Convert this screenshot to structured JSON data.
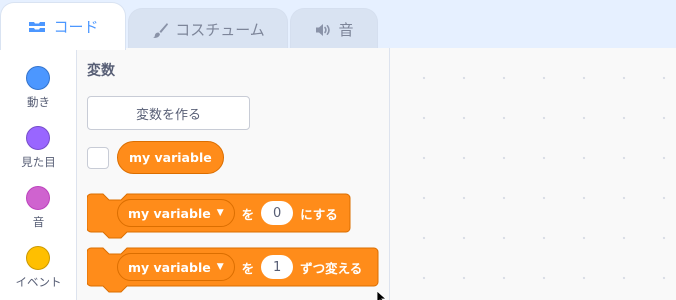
{
  "tabs": [
    {
      "label": "コード",
      "icon": "code-icon",
      "active": true
    },
    {
      "label": "コスチューム",
      "icon": "paintbrush-icon",
      "active": false
    },
    {
      "label": "音",
      "icon": "speaker-icon",
      "active": false
    }
  ],
  "categories": [
    {
      "label": "動き",
      "color": "#4c97ff",
      "border": "#3373cc"
    },
    {
      "label": "見た目",
      "color": "#9966ff",
      "border": "#774dcb"
    },
    {
      "label": "音",
      "color": "#cf63cf",
      "border": "#bd42bd"
    },
    {
      "label": "イベント",
      "color": "#ffbf00",
      "border": "#cc9900"
    }
  ],
  "flyout": {
    "title": "変数",
    "make_variable_button": "変数を作る",
    "variable": {
      "name": "my variable",
      "checked": false
    },
    "blocks": [
      {
        "variable": "my variable",
        "connector": "を",
        "value": "0",
        "suffix": "にする"
      },
      {
        "variable": "my variable",
        "connector": "を",
        "value": "1",
        "suffix": "ずつ変える"
      }
    ]
  },
  "colors": {
    "accent": "#4c97ff",
    "variables_block": "#ff8c1a",
    "variables_block_border": "#db6e00"
  }
}
